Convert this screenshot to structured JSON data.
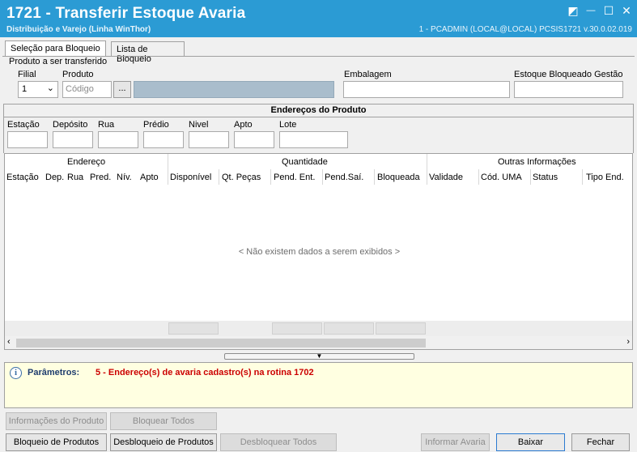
{
  "window": {
    "title": "1721 - Transferir Estoque Avaria",
    "subtitle": "Distribuição e Varejo (Linha WinThor)",
    "connection": "1 - PCADMIN (LOCAL@LOCAL)   PCSIS1721  v.30.0.02.019",
    "controls": {
      "restore": "◩",
      "minimize": "—",
      "maximize": "☐",
      "close": "✕"
    }
  },
  "tabs": [
    {
      "label": "Seleção para Bloqueio",
      "active": true
    },
    {
      "label": "Lista de Bloqueio",
      "active": false
    }
  ],
  "product_section": {
    "heading": "Produto a ser transferido",
    "filial_label": "Filial",
    "filial_value": "1",
    "produto_label": "Produto",
    "produto_placeholder": "Código",
    "lookup_button": "...",
    "embalagem_label": "Embalagem",
    "estoque_label": "Estoque Bloqueado Gestão"
  },
  "address_filter": {
    "header": "Endereços do Produto",
    "fields": [
      "Estação",
      "Depósito",
      "Rua",
      "Prédio",
      "Nivel",
      "Apto",
      "Lote"
    ]
  },
  "grid": {
    "groups": [
      "Endereço",
      "Quantidade",
      "Outras Informações"
    ],
    "columns": [
      "Estação",
      "Dep.",
      "Rua",
      "Pred.",
      "Nív.",
      "Apto",
      "Disponível",
      "Qt. Peças",
      "Pend. Ent.",
      "Pend.Saí.",
      "Bloqueada",
      "Validade",
      "Cód. UMA",
      "Status",
      "Tipo End."
    ],
    "empty_message": "< Não existem dados a serem exibidos >"
  },
  "params": {
    "label": "Parâmetros:",
    "value": "5 - Endereço(s) de avaria cadastro(s) na rotina 1702"
  },
  "buttons": {
    "info_produto": "Informações do Produto",
    "bloquear_todos": "Bloquear Todos",
    "bloqueio_produtos": "Bloqueio de Produtos",
    "desbloqueio_produtos": "Desbloqueio de Produtos",
    "desbloquear_todos": "Desbloquear Todos",
    "informar_avaria": "Informar Avaria",
    "baixar": "Baixar",
    "fechar": "Fechar"
  },
  "colors": {
    "titlebar": "#2b9bd4",
    "params_bg": "#ffffe1",
    "params_value": "#cc0000"
  }
}
